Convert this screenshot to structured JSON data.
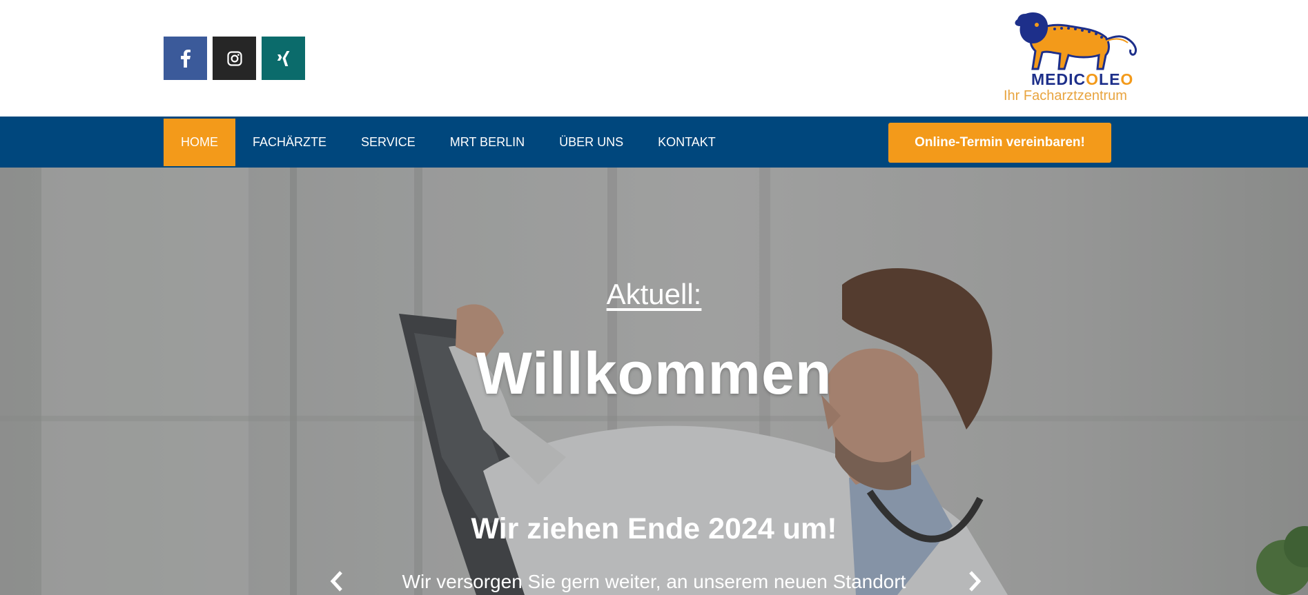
{
  "header": {
    "social": [
      {
        "name": "facebook",
        "icon": "facebook-icon",
        "color": "#3b5a9a"
      },
      {
        "name": "instagram",
        "icon": "instagram-icon",
        "color": "#262626"
      },
      {
        "name": "xing",
        "icon": "xing-icon",
        "color": "#0b6b6b"
      }
    ],
    "logo": {
      "brand_part1": "MEDIC",
      "brand_o1": "O",
      "brand_part2": "LE",
      "brand_o2": "O",
      "tagline": "Ihr Facharztzentrum"
    }
  },
  "nav": {
    "items": [
      {
        "label": "HOME",
        "active": true
      },
      {
        "label": "FACHÄRZTE"
      },
      {
        "label": "SERVICE"
      },
      {
        "label": "MRT BERLIN"
      },
      {
        "label": "ÜBER UNS"
      },
      {
        "label": "KONTAKT"
      }
    ],
    "cta_label": "Online-Termin vereinbaren!"
  },
  "hero": {
    "label": "Aktuell:",
    "headline": "Willkommen",
    "subheadline": "Wir ziehen Ende 2024 um!",
    "body": "Wir versorgen Sie gern weiter, an unserem neuen Standort",
    "prev_icon": "chevron-left-icon",
    "next_icon": "chevron-right-icon"
  },
  "colors": {
    "nav_background": "#00477d",
    "accent": "#f39a1a",
    "brand_blue": "#1d2f8a"
  }
}
